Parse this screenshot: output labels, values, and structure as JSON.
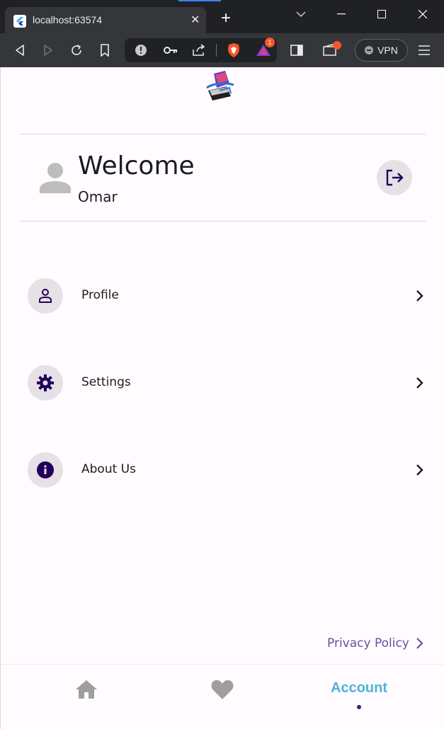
{
  "browser": {
    "tab_title": "localhost:63574",
    "close_tab": "✕",
    "new_tab": "+",
    "vpn_label": "VPN",
    "rewards_badge": "1"
  },
  "header": {
    "welcome": "Welcome",
    "username": "Omar"
  },
  "menu": {
    "items": [
      {
        "label": "Profile",
        "icon": "person-icon"
      },
      {
        "label": "Settings",
        "icon": "gear-icon"
      },
      {
        "label": "About Us",
        "icon": "info-icon"
      }
    ]
  },
  "footer": {
    "privacy_policy": "Privacy Policy"
  },
  "bottom_nav": {
    "items": [
      {
        "name": "home",
        "icon": "home-icon",
        "active": false
      },
      {
        "name": "favorites",
        "icon": "heart-icon",
        "active": false
      },
      {
        "name": "account",
        "label": "Account",
        "active": true
      }
    ]
  },
  "colors": {
    "background": "#fffbfe",
    "icon_primary": "#21005d",
    "accent_link": "#6750a4",
    "active_nav": "#4fb3d9",
    "inactive_nav": "#9e9e9e"
  }
}
